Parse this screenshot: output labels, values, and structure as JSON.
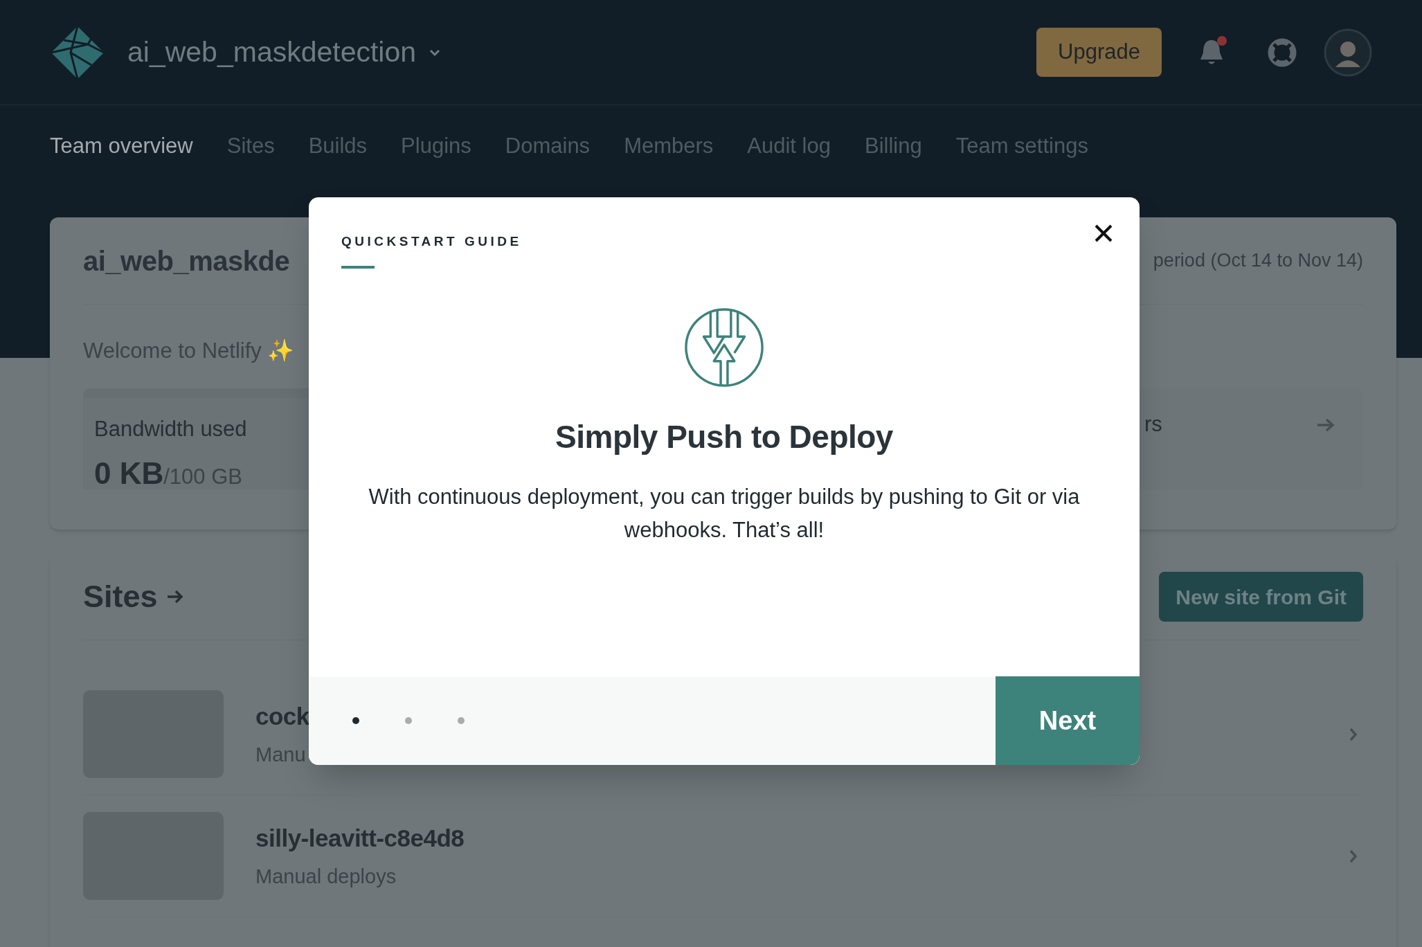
{
  "header": {
    "team_name": "ai_web_maskdetection",
    "upgrade_button": "Upgrade",
    "notification_unread": true
  },
  "nav": [
    {
      "label": "Team overview",
      "selected": true
    },
    {
      "label": "Sites",
      "selected": false
    },
    {
      "label": "Builds",
      "selected": false
    },
    {
      "label": "Plugins",
      "selected": false
    },
    {
      "label": "Domains",
      "selected": false
    },
    {
      "label": "Members",
      "selected": false
    },
    {
      "label": "Audit log",
      "selected": false
    },
    {
      "label": "Billing",
      "selected": false
    },
    {
      "label": "Team settings",
      "selected": false
    }
  ],
  "overview_card": {
    "title": "ai_web_maskde",
    "period": "period (Oct 14 to Nov 14)",
    "welcome": "Welcome to Netlify ✨",
    "bandwidth": {
      "label": "Bandwidth used",
      "value": "0 KB",
      "limit": "/100 GB"
    },
    "second_stat": "rs"
  },
  "sites_card": {
    "title": "Sites",
    "new_site_button": "New site from Git",
    "sites": [
      {
        "name": "cock",
        "subtitle": "Manu"
      },
      {
        "name": "silly-leavitt-c8e4d8",
        "subtitle": "Manual deploys"
      }
    ]
  },
  "modal": {
    "eyebrow": "QUICKSTART GUIDE",
    "title": "Simply Push to Deploy",
    "body": "With continuous deployment, you can trigger builds by pushing to Git or via webhooks. That’s all!",
    "steps": [
      {
        "selected": true
      },
      {
        "selected": false
      },
      {
        "selected": false
      }
    ],
    "next_button": "Next"
  }
}
